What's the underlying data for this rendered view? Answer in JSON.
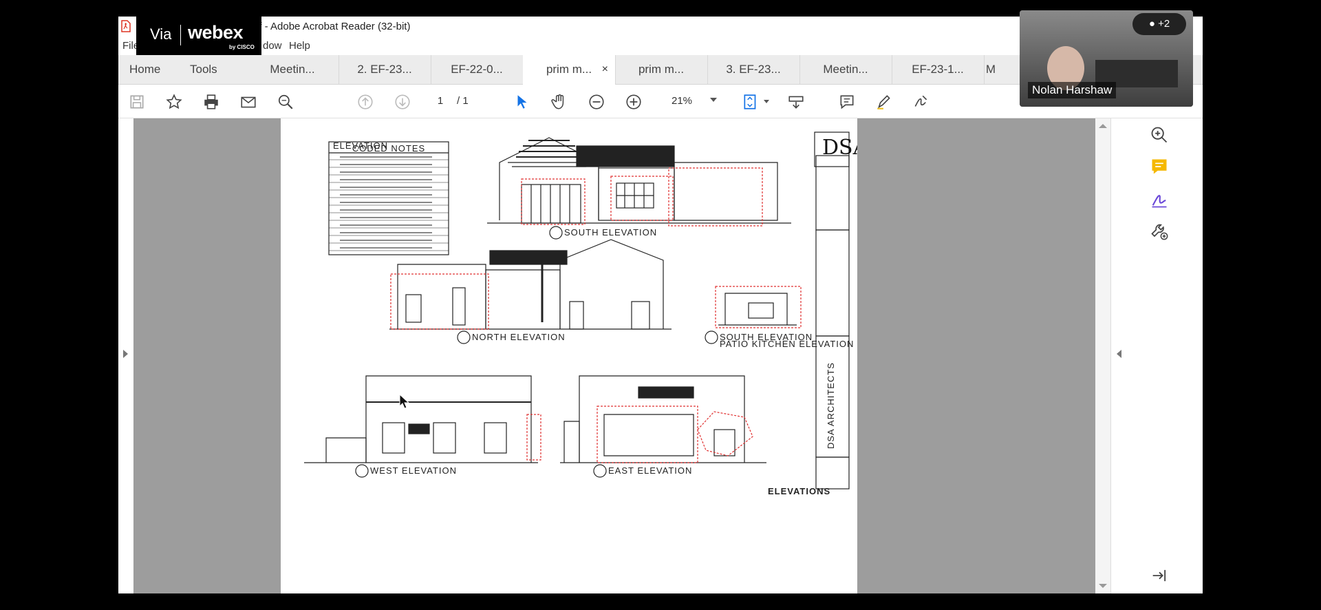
{
  "window": {
    "title": "df - Adobe Acrobat Reader (32-bit)"
  },
  "webex": {
    "via": "Via",
    "brand": "webex",
    "by": "by CISCO"
  },
  "menu": {
    "file": "File",
    "window": "dow",
    "help": "Help"
  },
  "tabs": {
    "home": "Home",
    "tools": "Tools",
    "docs": [
      {
        "label": "Meetin..."
      },
      {
        "label": "2. EF-23..."
      },
      {
        "label": "EF-22-0..."
      },
      {
        "label": "prim m...",
        "active": true
      },
      {
        "label": "prim m..."
      },
      {
        "label": "3. EF-23..."
      },
      {
        "label": "Meetin..."
      },
      {
        "label": "EF-23-1..."
      },
      {
        "label": "M"
      }
    ],
    "close_glyph": "×"
  },
  "toolbar": {
    "page_current": "1",
    "page_total": "/ 1",
    "zoom": "21%"
  },
  "drawing": {
    "notes_title": "ELEVATION",
    "notes_subtitle": "CODED NOTES",
    "labels": {
      "south": "SOUTH ELEVATION",
      "north": "NORTH ELEVATION",
      "south2": "SOUTH ELEVATION",
      "south2_sub": "PATIO KITCHEN ELEVATION",
      "west": "WEST ELEVATION",
      "east": "EAST ELEVATION",
      "sheet": "ELEVATIONS",
      "firm": "DSA ARCHITECTS"
    }
  },
  "video": {
    "name": "Nolan Harshaw",
    "participants": "+2"
  }
}
